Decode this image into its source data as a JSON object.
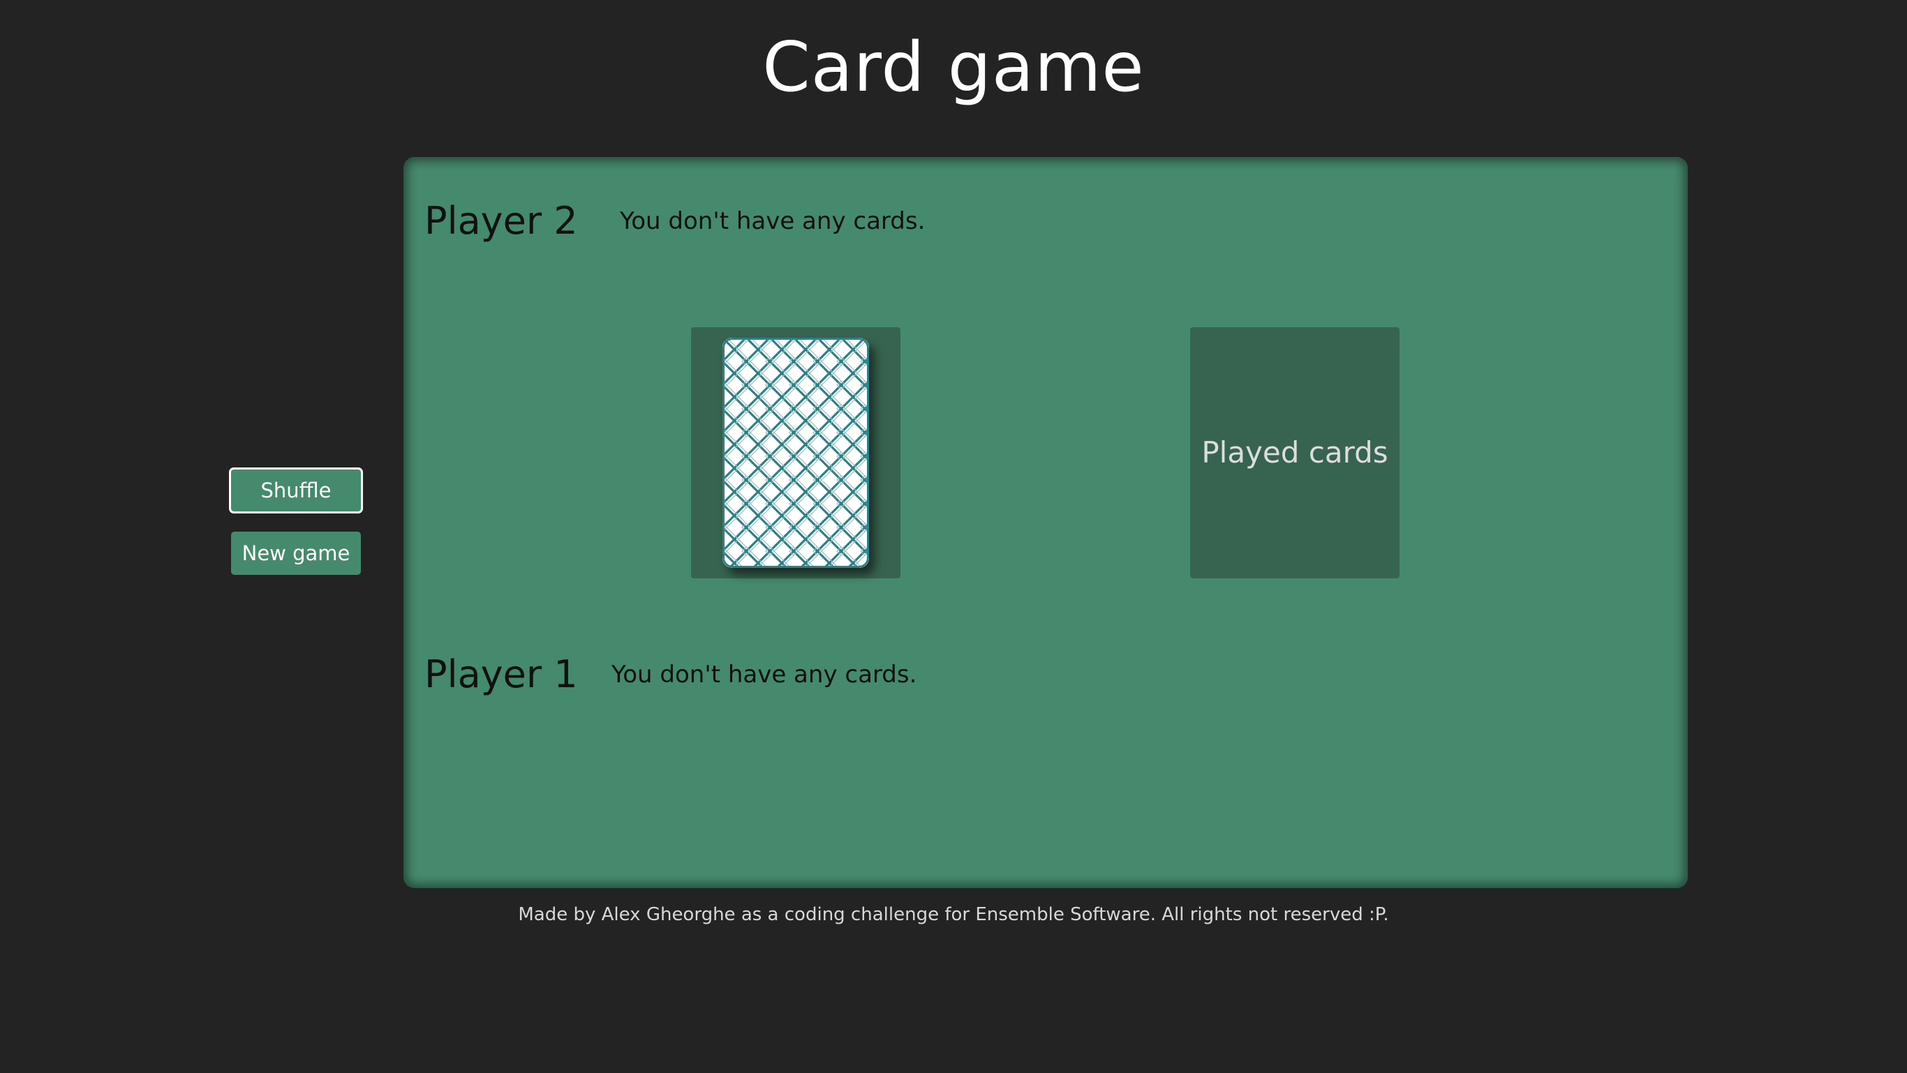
{
  "header": {
    "title": "Card game"
  },
  "sidebar": {
    "shuffle_label": "Shuffle",
    "new_game_label": "New game"
  },
  "board": {
    "player2": {
      "name": "Player 2",
      "message": "You don't have any cards."
    },
    "player1": {
      "name": "Player 1",
      "message": "You don't have any cards."
    },
    "deck": {
      "icon": "card-back-icon"
    },
    "played": {
      "label": "Played cards"
    }
  },
  "footer": {
    "text": "Made by Alex Gheorghe as a coding challenge for Ensemble Software. All rights not reserved :P."
  },
  "colors": {
    "background": "#232323",
    "table": "#468a6d",
    "slot": "#376450",
    "card_pattern": "#2e7f86"
  }
}
